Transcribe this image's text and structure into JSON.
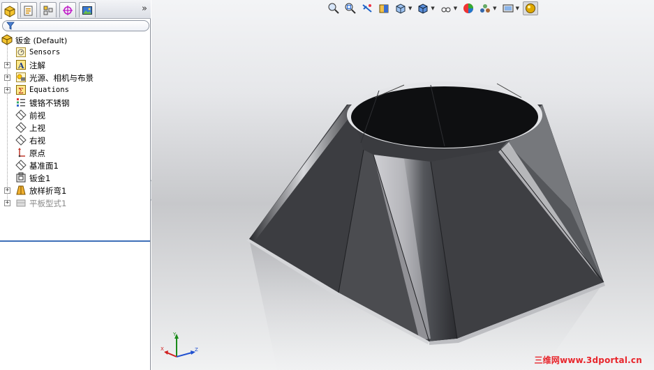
{
  "feature_manager": {
    "tabs": [
      {
        "name": "feature-manager-tab",
        "icon": "feature-tree-icon",
        "active": true
      },
      {
        "name": "property-manager-tab",
        "icon": "property-manager-icon",
        "active": false
      },
      {
        "name": "configuration-manager-tab",
        "icon": "configuration-manager-icon",
        "active": false
      },
      {
        "name": "dimxpert-manager-tab",
        "icon": "dimxpert-icon",
        "active": false
      },
      {
        "name": "display-manager-tab",
        "icon": "display-manager-icon",
        "active": false
      }
    ],
    "expand_chevron": "»",
    "tree": {
      "root": {
        "label": "钣金  (Default)",
        "icon": "part-icon"
      },
      "items": [
        {
          "label": "Sensors",
          "icon": "sensors-icon",
          "expandable": false,
          "mono": true
        },
        {
          "label": "注解",
          "icon": "annotations-icon",
          "expandable": true
        },
        {
          "label": "光源、相机与布景",
          "icon": "lights-cameras-icon",
          "expandable": true
        },
        {
          "label": "Equations",
          "icon": "equations-icon",
          "expandable": true,
          "mono": true
        },
        {
          "label": "镀铬不锈钢",
          "icon": "material-icon",
          "expandable": false
        },
        {
          "label": "前视",
          "icon": "plane-icon",
          "expandable": false
        },
        {
          "label": "上视",
          "icon": "plane-icon",
          "expandable": false
        },
        {
          "label": "右视",
          "icon": "plane-icon",
          "expandable": false
        },
        {
          "label": "原点",
          "icon": "origin-icon",
          "expandable": false
        },
        {
          "label": "基准面1",
          "icon": "plane-icon",
          "expandable": false
        },
        {
          "label": "钣金1",
          "icon": "sheet-metal-icon",
          "expandable": false
        },
        {
          "label": "放样折弯1",
          "icon": "lofted-bend-icon",
          "expandable": true
        },
        {
          "label": "平板型式1",
          "icon": "flat-pattern-icon",
          "expandable": true,
          "suppressed": true
        }
      ]
    }
  },
  "heads_up_toolbar": [
    "zoom-to-fit-icon",
    "zoom-to-area-icon",
    "previous-view-icon",
    "section-view-icon",
    "view-orientation-icon",
    "display-style-icon",
    "hide-show-items-icon",
    "edit-appearance-icon",
    "apply-scene-icon",
    "view-settings-icon",
    "realview-icon"
  ],
  "triad": {
    "x_label": "X",
    "y_label": "Y",
    "z_label": "Z"
  },
  "watermark": {
    "text": "三维网www.3dportal.cn"
  },
  "colors": {
    "selection_line": "#3d6fb8",
    "watermark": "#e8262c",
    "origin_red": "#c0392b"
  }
}
